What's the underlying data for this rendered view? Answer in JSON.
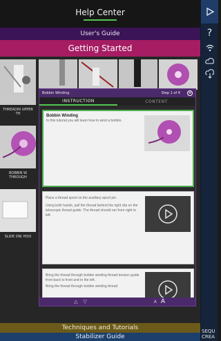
{
  "header": {
    "title": "Help Center",
    "users_guide": "User's Guide",
    "section": "Getting Started"
  },
  "tutorial_tiles": [
    {
      "label": "THREADIN UPPER TH"
    },
    {
      "label": "BOBBIN W THROUGH"
    },
    {
      "label": "SLIDE ON/ HOO"
    }
  ],
  "dialog": {
    "title": "Bobbin Winding",
    "step": "Step 1 of 4",
    "close": "⊗",
    "tabs": [
      "INSTRUCTION",
      "CONTENT"
    ],
    "cards": [
      {
        "title": "Bobbin Winding",
        "text": "In this tutorial you will learn how to wind a bobbin."
      },
      {
        "title": "",
        "text": "Place a thread spool on the auxiliary spool pin.",
        "text2": "Using both hands, pull the thread behind the right clip on the telescopic thread guide. The thread should run from right to left."
      },
      {
        "title": "",
        "text": "Bring the thread through bobbin winding thread tension guide from back to front and to the left.",
        "text2": "Bring the thread through bobbin winding thread"
      }
    ],
    "footer": {
      "prev": "△",
      "next": "▽",
      "font_small": "A",
      "font_large": "A"
    }
  },
  "bottom": {
    "techniques": "Techniques and Tutorials",
    "stabilizer": "Stabilizer Guide"
  },
  "sidebar": {
    "seq_line1": "SEQU",
    "seq_line2": "CREA"
  },
  "colors": {
    "accent_green": "#53c653",
    "purple": "#4b2a6b",
    "magenta": "#a61d64",
    "gold": "#6b5a1a",
    "blue": "#1c3f6b"
  }
}
